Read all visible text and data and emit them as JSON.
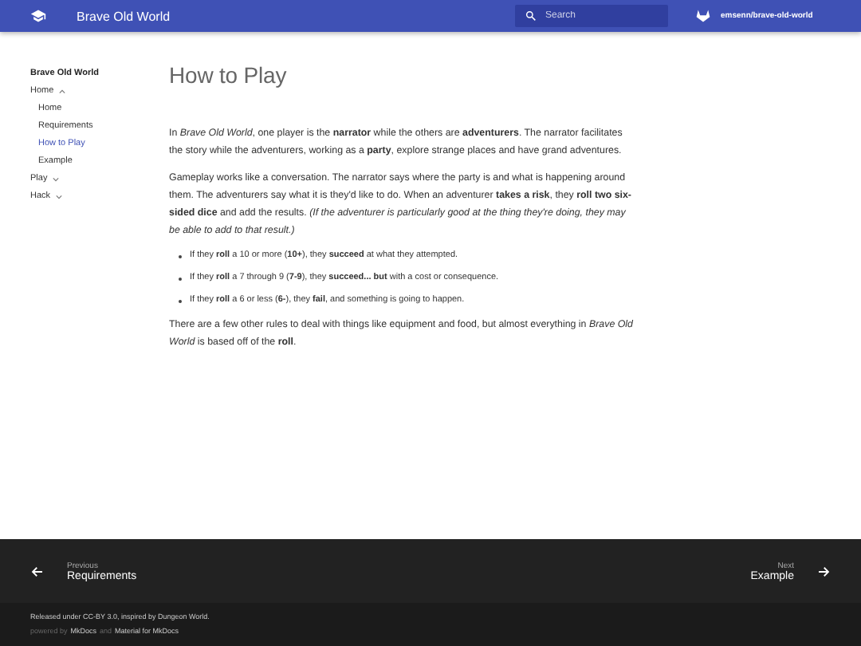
{
  "header": {
    "site_title": "Brave Old World",
    "search": {
      "placeholder": "Search"
    },
    "repo": "emsenn/brave-old-world"
  },
  "sidebar": {
    "title": "Brave Old World",
    "items": [
      {
        "label": "Home",
        "expanded": true,
        "selected": false,
        "children": [
          {
            "label": "Home",
            "selected": false
          },
          {
            "label": "Requirements",
            "selected": false
          },
          {
            "label": "How to Play",
            "selected": true
          },
          {
            "label": "Example",
            "selected": false
          }
        ]
      },
      {
        "label": "Play",
        "expanded": false,
        "selected": false
      },
      {
        "label": "Hack",
        "expanded": false,
        "selected": false
      }
    ]
  },
  "content": {
    "title": "How to Play",
    "paragraphs_before": [
      "In *Brave Old World*, one player is the **narrator** while the others are **adventurers**. The narrator facilitates the story while the adventurers, working as a **party**, explore strange places and have grand adventures.",
      "Gameplay works like a conversation. The narrator says where the party is and what is happening around them. The adventurers say what it is they'd like to do. When an adventurer **takes a risk**, they **roll two six-sided dice** and add the results. *(If the adventurer is particularly good at the thing they're doing, they may be able to add to that result.)*"
    ],
    "bullets": [
      "If they **roll** a 10 or more (**10+**), they **succeed** at what they attempted.",
      "If they **roll** a 7 through 9 (**7-9**), they **succeed... but** with a cost or consequence.",
      "If they **roll** a 6 or less (**6-**), they **fail**, and something is going to happen."
    ],
    "paragraphs_after": [
      "There are a few other rules to deal with things like equipment and food, but almost everything in *Brave Old World* is based off of the **roll**."
    ]
  },
  "footer": {
    "previous": {
      "caption": "Previous",
      "title": "Requirements"
    },
    "next": {
      "caption": "Next",
      "title": "Example"
    },
    "license": "Released under CC-BY 3.0, inspired by Dungeon World.",
    "credits": [
      {
        "kind": "text",
        "text": "powered by"
      },
      {
        "kind": "link",
        "text": "MkDocs"
      },
      {
        "kind": "text",
        "text": "and"
      },
      {
        "kind": "link",
        "text": "Material for MkDocs"
      }
    ]
  }
}
